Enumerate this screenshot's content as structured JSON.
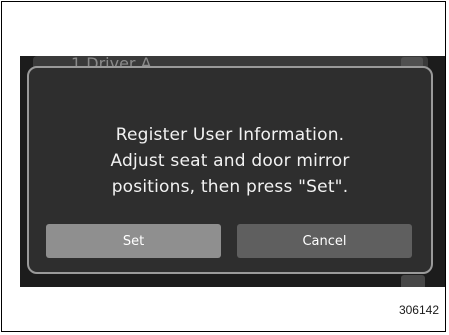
{
  "background": {
    "driver_label": "1 Driver A"
  },
  "dialog": {
    "message_lines": [
      "Register User Information.",
      "Adjust seat and door mirror",
      "positions, then press \"Set\"."
    ],
    "set_label": "Set",
    "cancel_label": "Cancel"
  },
  "figure_code": "306142",
  "colors": {
    "screen_bg": "#1c1c1c",
    "dialog_bg": "#2e2e2e",
    "set_button": "#8f8f8f",
    "cancel_button": "#5f5f5f"
  }
}
